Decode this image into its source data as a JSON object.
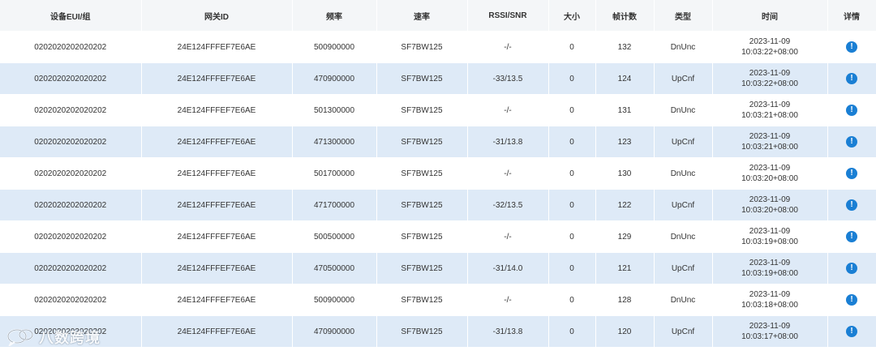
{
  "headers": [
    "设备EUI/组",
    "网关ID",
    "频率",
    "速率",
    "RSSI/SNR",
    "大小",
    "帧计数",
    "类型",
    "时间",
    "详情"
  ],
  "rows": [
    {
      "eui": "0202020202020202",
      "gateway": "24E124FFFEF7E6AE",
      "freq": "500900000",
      "rate": "SF7BW125",
      "rssi": "-/-",
      "size": "0",
      "fcnt": "132",
      "type": "DnUnc",
      "date": "2023-11-09",
      "time": "10:03:22+08:00"
    },
    {
      "eui": "0202020202020202",
      "gateway": "24E124FFFEF7E6AE",
      "freq": "470900000",
      "rate": "SF7BW125",
      "rssi": "-33/13.5",
      "size": "0",
      "fcnt": "124",
      "type": "UpCnf",
      "date": "2023-11-09",
      "time": "10:03:22+08:00"
    },
    {
      "eui": "0202020202020202",
      "gateway": "24E124FFFEF7E6AE",
      "freq": "501300000",
      "rate": "SF7BW125",
      "rssi": "-/-",
      "size": "0",
      "fcnt": "131",
      "type": "DnUnc",
      "date": "2023-11-09",
      "time": "10:03:21+08:00"
    },
    {
      "eui": "0202020202020202",
      "gateway": "24E124FFFEF7E6AE",
      "freq": "471300000",
      "rate": "SF7BW125",
      "rssi": "-31/13.8",
      "size": "0",
      "fcnt": "123",
      "type": "UpCnf",
      "date": "2023-11-09",
      "time": "10:03:21+08:00"
    },
    {
      "eui": "0202020202020202",
      "gateway": "24E124FFFEF7E6AE",
      "freq": "501700000",
      "rate": "SF7BW125",
      "rssi": "-/-",
      "size": "0",
      "fcnt": "130",
      "type": "DnUnc",
      "date": "2023-11-09",
      "time": "10:03:20+08:00"
    },
    {
      "eui": "0202020202020202",
      "gateway": "24E124FFFEF7E6AE",
      "freq": "471700000",
      "rate": "SF7BW125",
      "rssi": "-32/13.5",
      "size": "0",
      "fcnt": "122",
      "type": "UpCnf",
      "date": "2023-11-09",
      "time": "10:03:20+08:00"
    },
    {
      "eui": "0202020202020202",
      "gateway": "24E124FFFEF7E6AE",
      "freq": "500500000",
      "rate": "SF7BW125",
      "rssi": "-/-",
      "size": "0",
      "fcnt": "129",
      "type": "DnUnc",
      "date": "2023-11-09",
      "time": "10:03:19+08:00"
    },
    {
      "eui": "0202020202020202",
      "gateway": "24E124FFFEF7E6AE",
      "freq": "470500000",
      "rate": "SF7BW125",
      "rssi": "-31/14.0",
      "size": "0",
      "fcnt": "121",
      "type": "UpCnf",
      "date": "2023-11-09",
      "time": "10:03:19+08:00"
    },
    {
      "eui": "0202020202020202",
      "gateway": "24E124FFFEF7E6AE",
      "freq": "500900000",
      "rate": "SF7BW125",
      "rssi": "-/-",
      "size": "0",
      "fcnt": "128",
      "type": "DnUnc",
      "date": "2023-11-09",
      "time": "10:03:18+08:00"
    },
    {
      "eui": "0202020202020202",
      "gateway": "24E124FFFEF7E6AE",
      "freq": "470900000",
      "rate": "SF7BW125",
      "rssi": "-31/13.8",
      "size": "0",
      "fcnt": "120",
      "type": "UpCnf",
      "date": "2023-11-09",
      "time": "10:03:17+08:00"
    }
  ],
  "detail_icon": "info-circle-icon",
  "detail_glyph": "!",
  "watermark": {
    "text": "八数跨境",
    "icon": "chat-bubble-logo"
  },
  "colors": {
    "header_bg": "#f4f6f8",
    "stripe_bg": "#deeaf7",
    "info_blue": "#1a7fd4"
  }
}
